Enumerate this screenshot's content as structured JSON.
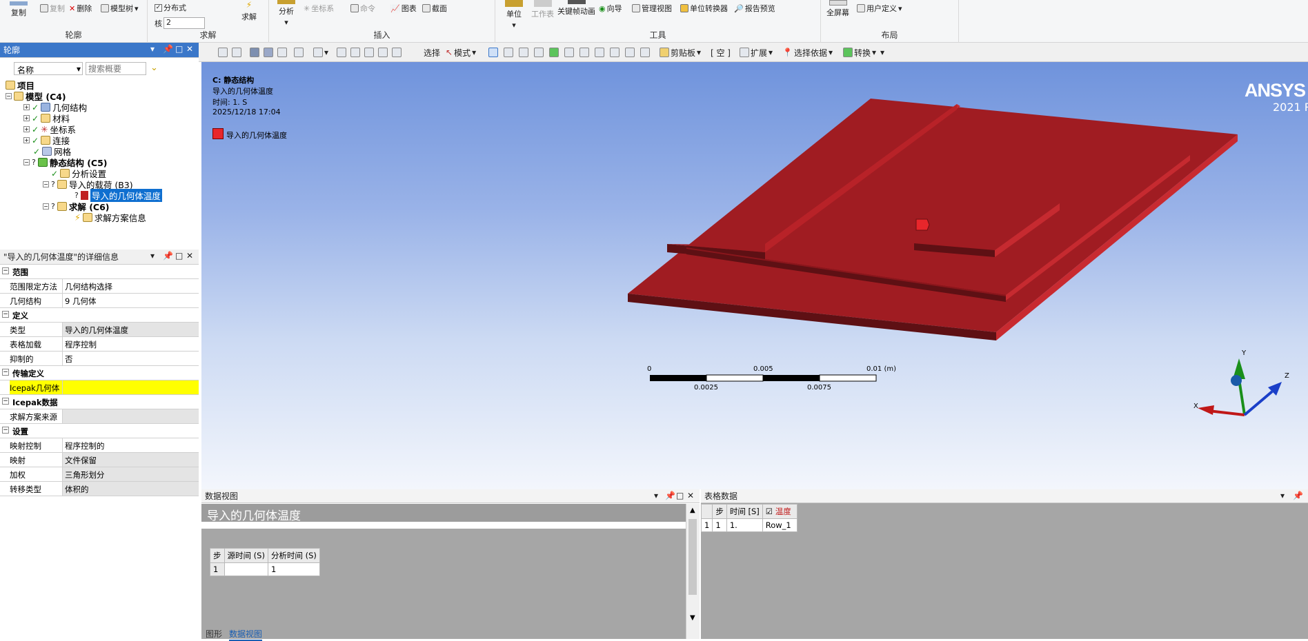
{
  "ribbon": {
    "outline_group": {
      "label": "轮廓",
      "copy": "复制",
      "duplicate": "复制",
      "delete": "删除",
      "model_tree": "模型树"
    },
    "solve_group": {
      "label": "求解",
      "distributed": "分布式",
      "cores_label": "核",
      "cores_value": "2",
      "solve": "求解"
    },
    "insert_group": {
      "label": "插入",
      "analysis": "分析",
      "coord_sys": "坐标系",
      "command": "命令",
      "chart": "图表",
      "section": "截面"
    },
    "tools_group": {
      "label": "工具",
      "units": "单位",
      "worksheet": "工作表",
      "keyframe": "关键帧动画",
      "wizard": "向导",
      "manage_views": "管理视图",
      "unit_converter": "单位转换器",
      "report_preview": "报告预览"
    },
    "layout_group": {
      "label": "布局",
      "fullscreen": "全屏幕",
      "user_defined": "用户定义"
    }
  },
  "toolbar": {
    "select": "选择",
    "mode": "模式",
    "clipboard": "剪贴板",
    "empty": "[ 空 ]",
    "extend": "扩展",
    "select_by": "选择依据",
    "convert": "转换"
  },
  "outline": {
    "title": "轮廓",
    "filter_field": "名称",
    "search_placeholder": "搜索概要",
    "tree": {
      "project": "项目",
      "model": "模型 (C4)",
      "geometry": "几何结构",
      "materials": "材料",
      "coordinate_systems": "坐标系",
      "connections": "连接",
      "mesh": "网格",
      "static_structural": "静态结构 (C5)",
      "analysis_settings": "分析设置",
      "imported_load": "导入的载荷 (B3)",
      "imported_body_temp": "导入的几何体温度",
      "solution": "求解 (C6)",
      "solution_info": "求解方案信息"
    }
  },
  "details": {
    "title": "\"导入的几何体温度\"的详细信息",
    "rows": [
      {
        "type": "section",
        "label": "范围"
      },
      {
        "key": "范围限定方法",
        "value": "几何结构选择"
      },
      {
        "key": "几何结构",
        "value": "9 几何体"
      },
      {
        "type": "section",
        "label": "定义"
      },
      {
        "key": "类型",
        "value": "导入的几何体温度",
        "grey": true
      },
      {
        "key": "表格加载",
        "value": "程序控制"
      },
      {
        "key": "抑制的",
        "value": "否"
      },
      {
        "type": "section",
        "label": "传输定义"
      },
      {
        "key": "Icepak几何体",
        "value": "",
        "yellow": true
      },
      {
        "type": "section",
        "label": "Icepak数据"
      },
      {
        "key": "求解方案来源",
        "value": "",
        "grey": true
      },
      {
        "type": "section",
        "label": "设置"
      },
      {
        "key": "映射控制",
        "value": "程序控制的"
      },
      {
        "key": "映射",
        "value": "文件保留",
        "grey": true
      },
      {
        "key": "加权",
        "value": "三角形划分",
        "grey": true
      },
      {
        "key": "转移类型",
        "value": "体积的",
        "grey": true
      }
    ]
  },
  "viewport": {
    "analysis": "C: 静态结构",
    "item": "导入的几何体温度",
    "time": "时间: 1. S",
    "date": "2025/12/18 17:04",
    "legend": "导入的几何体温度",
    "brand": "ANSYS",
    "version": "2021 R",
    "scale_labels": {
      "s0": "0",
      "s1": "0.005",
      "s2": "0.01 (m)",
      "s3": "0.0025",
      "s4": "0.0075"
    },
    "axes": {
      "x": "X",
      "y": "Y",
      "z": "Z"
    },
    "colors": {
      "body": "#a01c22",
      "dark": "#5e1014",
      "legend": "#e8262b"
    }
  },
  "data_view": {
    "title": "数据视图",
    "heading": "导入的几何体温度",
    "columns": [
      "步",
      "源时间 (S)",
      "分析时间 (S)"
    ],
    "rows": [
      [
        "1",
        "",
        "1"
      ]
    ]
  },
  "tabular": {
    "title": "表格数据",
    "columns": [
      "步",
      "时间 [S]",
      "温度"
    ],
    "rows": [
      [
        "1",
        "1",
        "1.",
        "Row_1"
      ]
    ]
  },
  "tabs": {
    "graph": "图形",
    "data_view": "数据视图"
  }
}
